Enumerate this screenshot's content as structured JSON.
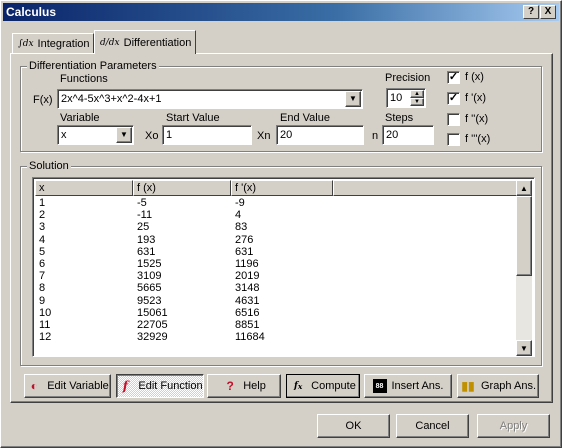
{
  "window": {
    "title": "Calculus",
    "help_btn": "?",
    "close_btn": "X"
  },
  "tabs": [
    {
      "label": "Integration",
      "icon": "integral-icon",
      "icon_glyph": "∫dx",
      "active": false
    },
    {
      "label": "Differentiation",
      "icon": "derivative-icon",
      "icon_glyph": "d/dx",
      "active": true
    }
  ],
  "params": {
    "group_label": "Differentiation Parameters",
    "functions_label": "Functions",
    "fx_label": "F(x)",
    "function_value": "2x^4-5x^3+x^2-4x+1",
    "precision_label": "Precision",
    "precision_value": "10",
    "variable_label": "Variable",
    "variable_value": "x",
    "start_label": "Start Value",
    "xo_label": "Xo",
    "start_value": "1",
    "end_label": "End Value",
    "xn_label": "Xn",
    "end_value": "20",
    "steps_label": "Steps",
    "n_label": "n",
    "steps_value": "20",
    "checks": [
      {
        "label": "f (x)",
        "checked": true
      },
      {
        "label": "f '(x)",
        "checked": true
      },
      {
        "label": "f ''(x)",
        "checked": false
      },
      {
        "label": "f '''(x)",
        "checked": false
      }
    ]
  },
  "solution": {
    "group_label": "Solution",
    "columns": [
      "x",
      "f (x)",
      "f '(x)"
    ],
    "rows": [
      [
        "1",
        "-5",
        "-9"
      ],
      [
        "2",
        "-11",
        "4"
      ],
      [
        "3",
        "25",
        "83"
      ],
      [
        "4",
        "193",
        "276"
      ],
      [
        "5",
        "631",
        "631"
      ],
      [
        "6",
        "1525",
        "1196"
      ],
      [
        "7",
        "3109",
        "2019"
      ],
      [
        "8",
        "5665",
        "3148"
      ],
      [
        "9",
        "9523",
        "4631"
      ],
      [
        "10",
        "15061",
        "6516"
      ],
      [
        "11",
        "22705",
        "8851"
      ],
      [
        "12",
        "32929",
        "11684"
      ]
    ]
  },
  "buttons": {
    "edit_variable": "Edit Variable",
    "edit_function": "Edit Function",
    "help": "Help",
    "compute": "Compute",
    "insert_ans": "Insert Ans.",
    "graph_ans": "Graph Ans.",
    "ok": "OK",
    "cancel": "Cancel",
    "apply": "Apply"
  },
  "colors": {
    "title_start": "#0a246a",
    "title_end": "#a6caf0",
    "face": "#d4d0c8"
  }
}
